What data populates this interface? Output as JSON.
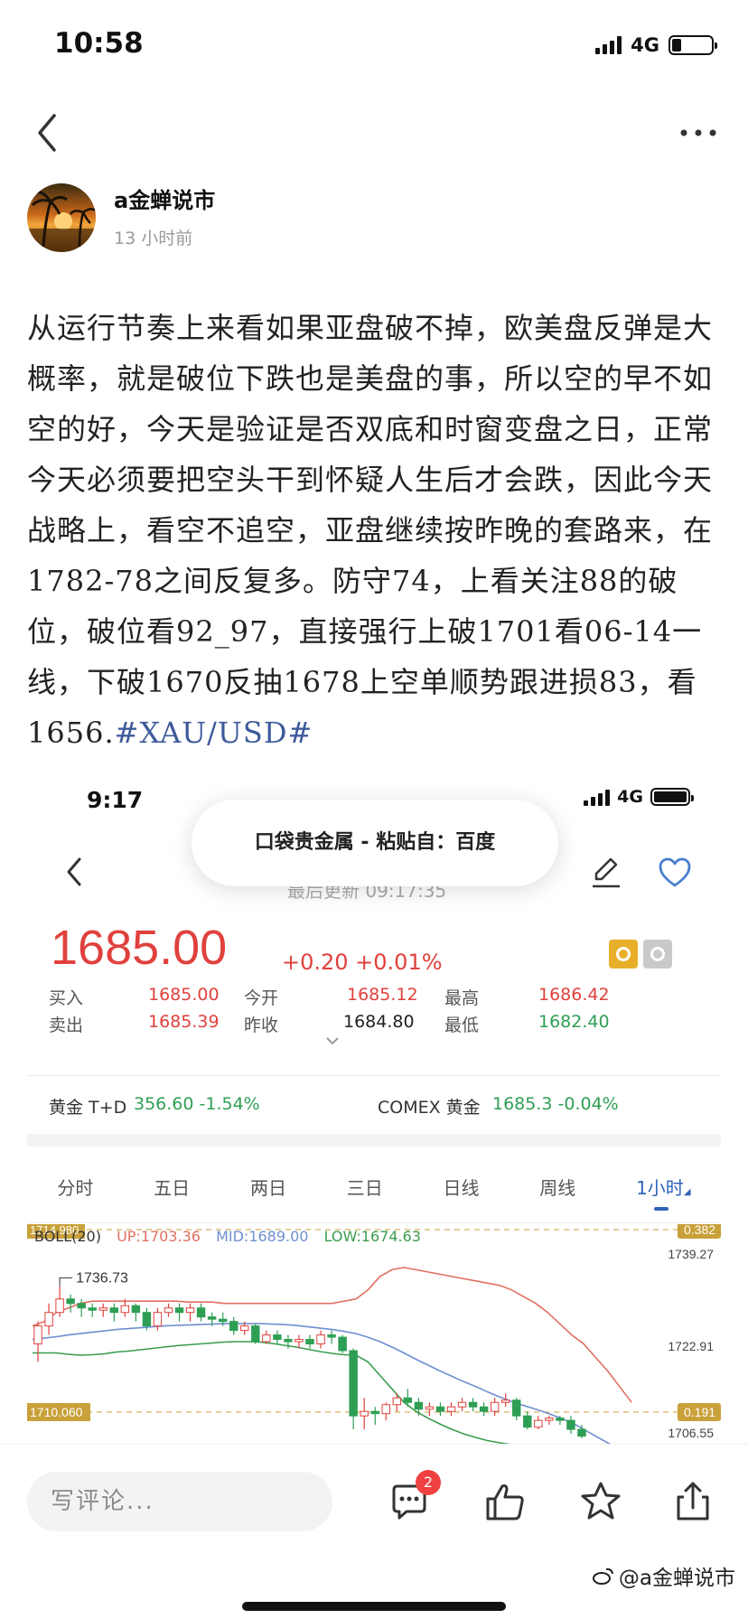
{
  "status_bar": {
    "time": "10:58",
    "network": "4G"
  },
  "author": {
    "name": "a金蝉说市",
    "time": "13 小时前"
  },
  "post": {
    "body": "从运行节奏上来看如果亚盘破不掉，欧美盘反弹是大概率，就是破位下跌也是美盘的事，所以空的早不如空的好，今天是验证是否双底和时窗变盘之日，正常今天必须要把空头干到怀疑人生后才会跌，因此今天战略上，看空不追空，亚盘继续按昨晚的套路来，在1782-78之间反复多。防守74，上看关注88的破位，破位看92_97，直接强行上破1701看06-14一线，下破1670反抽1678上空单顺势跟进损83，看1656.",
    "hashtag": "#XAU/USD#"
  },
  "embedded_screenshot": {
    "status_time": "9:17",
    "network": "4G",
    "paste_toast": "口袋贵金属 - 粘贴自：百度",
    "last_update": "最后更新 09:17:35",
    "price": "1685.00",
    "change": "+0.20 +0.01%",
    "quotes": {
      "buy_label": "买入",
      "buy": "1685.00",
      "sell_label": "卖出",
      "sell": "1685.39",
      "open_label": "今开",
      "open": "1685.12",
      "prev_close_label": "昨收",
      "prev_close": "1684.80",
      "high_label": "最高",
      "high": "1686.42",
      "low_label": "最低",
      "low": "1682.40"
    },
    "refs": {
      "td_label": "黄金 T+D",
      "td_value": "356.60 -1.54%",
      "comex_label": "COMEX 黄金",
      "comex_value": "1685.3 -0.04%"
    },
    "tabs": [
      "分时",
      "五日",
      "两日",
      "三日",
      "日线",
      "周线",
      "1小时"
    ],
    "active_tab": "1小时",
    "colors": {
      "up": "#e0413d",
      "down": "#2e9e54",
      "active": "#2f63b8",
      "upper_band": "#e07060",
      "mid_band": "#6f8fd0",
      "lower_band": "#3a9c50",
      "label_bg": "#c9a13a"
    },
    "chart_data": {
      "type": "candlestick",
      "indicator": "BOLL(20)",
      "up_label": "UP:1703.36",
      "mid_label": "MID:1689.00",
      "low_label": "LOW:1674.63",
      "left_top_label": "1714.980",
      "high_marker": "1736.73",
      "right_ticks": [
        "1739.27",
        "1722.91",
        "1706.55"
      ],
      "dashed_left_label": "1710.060",
      "dashed_right_top": "0.382",
      "dashed_right_mid": "0.191",
      "ylim": [
        1700,
        1745
      ],
      "candles": [
        {
          "o": 1724,
          "c": 1728,
          "h": 1729,
          "l": 1720
        },
        {
          "o": 1728,
          "c": 1731,
          "h": 1733,
          "l": 1726
        },
        {
          "o": 1731,
          "c": 1734,
          "h": 1736.7,
          "l": 1730
        },
        {
          "o": 1734,
          "c": 1733,
          "h": 1735,
          "l": 1731
        },
        {
          "o": 1733,
          "c": 1732,
          "h": 1734,
          "l": 1730
        },
        {
          "o": 1732,
          "c": 1731.5,
          "h": 1733,
          "l": 1730
        },
        {
          "o": 1731.5,
          "c": 1732,
          "h": 1733,
          "l": 1730
        },
        {
          "o": 1732,
          "c": 1731,
          "h": 1733,
          "l": 1729
        },
        {
          "o": 1731,
          "c": 1732.5,
          "h": 1734,
          "l": 1730
        },
        {
          "o": 1732.5,
          "c": 1731,
          "h": 1733,
          "l": 1729
        },
        {
          "o": 1731,
          "c": 1728,
          "h": 1732,
          "l": 1727
        },
        {
          "o": 1728,
          "c": 1731,
          "h": 1732,
          "l": 1727
        },
        {
          "o": 1731,
          "c": 1732,
          "h": 1733,
          "l": 1730
        },
        {
          "o": 1732,
          "c": 1731,
          "h": 1733,
          "l": 1729
        },
        {
          "o": 1731,
          "c": 1732,
          "h": 1733,
          "l": 1729
        },
        {
          "o": 1732,
          "c": 1730,
          "h": 1733,
          "l": 1729
        },
        {
          "o": 1730,
          "c": 1729.5,
          "h": 1731,
          "l": 1728
        },
        {
          "o": 1729.5,
          "c": 1729,
          "h": 1731,
          "l": 1728
        },
        {
          "o": 1729,
          "c": 1727,
          "h": 1730,
          "l": 1726
        },
        {
          "o": 1727,
          "c": 1728,
          "h": 1729,
          "l": 1726
        },
        {
          "o": 1728,
          "c": 1724.5,
          "h": 1728.5,
          "l": 1724
        },
        {
          "o": 1724.5,
          "c": 1726,
          "h": 1727,
          "l": 1724
        },
        {
          "o": 1726,
          "c": 1725,
          "h": 1727,
          "l": 1724
        },
        {
          "o": 1725,
          "c": 1724.5,
          "h": 1726,
          "l": 1723
        },
        {
          "o": 1724.5,
          "c": 1725,
          "h": 1726,
          "l": 1723
        },
        {
          "o": 1725,
          "c": 1724,
          "h": 1726,
          "l": 1723
        },
        {
          "o": 1724,
          "c": 1726,
          "h": 1727,
          "l": 1723
        },
        {
          "o": 1726,
          "c": 1725.5,
          "h": 1727,
          "l": 1724
        },
        {
          "o": 1725.5,
          "c": 1722.5,
          "h": 1726,
          "l": 1722
        },
        {
          "o": 1722.5,
          "c": 1708,
          "h": 1723,
          "l": 1705
        },
        {
          "o": 1708,
          "c": 1709,
          "h": 1712,
          "l": 1705
        },
        {
          "o": 1709,
          "c": 1708.5,
          "h": 1710,
          "l": 1706
        },
        {
          "o": 1708.5,
          "c": 1710.5,
          "h": 1711,
          "l": 1707
        },
        {
          "o": 1710.5,
          "c": 1712,
          "h": 1713,
          "l": 1709
        },
        {
          "o": 1712,
          "c": 1711,
          "h": 1714,
          "l": 1710
        },
        {
          "o": 1711,
          "c": 1709.5,
          "h": 1712,
          "l": 1708
        },
        {
          "o": 1709.5,
          "c": 1710,
          "h": 1711,
          "l": 1708
        },
        {
          "o": 1710,
          "c": 1709,
          "h": 1711,
          "l": 1708
        },
        {
          "o": 1709,
          "c": 1710,
          "h": 1711,
          "l": 1708
        },
        {
          "o": 1710,
          "c": 1711,
          "h": 1712,
          "l": 1709
        },
        {
          "o": 1711,
          "c": 1710,
          "h": 1712,
          "l": 1709
        },
        {
          "o": 1710,
          "c": 1709,
          "h": 1711,
          "l": 1708
        },
        {
          "o": 1709,
          "c": 1711,
          "h": 1712,
          "l": 1708
        },
        {
          "o": 1711,
          "c": 1711.5,
          "h": 1713,
          "l": 1710
        },
        {
          "o": 1711.5,
          "c": 1708,
          "h": 1712,
          "l": 1707
        },
        {
          "o": 1708,
          "c": 1705.5,
          "h": 1709,
          "l": 1705
        },
        {
          "o": 1705.5,
          "c": 1707,
          "h": 1708,
          "l": 1705
        },
        {
          "o": 1707,
          "c": 1707.5,
          "h": 1708,
          "l": 1706
        },
        {
          "o": 1707.5,
          "c": 1707,
          "h": 1708,
          "l": 1706
        },
        {
          "o": 1707,
          "c": 1705,
          "h": 1708,
          "l": 1704
        },
        {
          "o": 1705,
          "c": 1703.5,
          "h": 1706,
          "l": 1703
        }
      ],
      "upper_band": [
        1728,
        1729,
        1731,
        1732,
        1733,
        1733.5,
        1733.5,
        1733.5,
        1733.5,
        1733.5,
        1733.5,
        1733.5,
        1733.5,
        1733.3,
        1733.3,
        1733.3,
        1733,
        1733,
        1733,
        1733,
        1733,
        1733,
        1733,
        1733,
        1733,
        1733,
        1733.5,
        1734,
        1736,
        1739,
        1740.5,
        1741,
        1740.5,
        1740,
        1739.5,
        1739,
        1738.5,
        1738,
        1737.5,
        1737,
        1736,
        1734.5,
        1733,
        1731,
        1728.5,
        1726,
        1724,
        1721,
        1718,
        1714.5,
        1711
      ],
      "mid_band": [
        1725,
        1725.3,
        1725.6,
        1726,
        1726.3,
        1726.6,
        1726.9,
        1727.2,
        1727.4,
        1727.6,
        1727.8,
        1728,
        1728.1,
        1728.2,
        1728.3,
        1728.4,
        1728.5,
        1728.5,
        1728.5,
        1728.5,
        1728.4,
        1728.3,
        1728.1,
        1727.8,
        1727.5,
        1727.2,
        1726.8,
        1726.3,
        1725.5,
        1724.5,
        1723.3,
        1722,
        1720.6,
        1719.3,
        1718,
        1716.8,
        1715.6,
        1714.5,
        1713.3,
        1712.2,
        1711.2,
        1710.3,
        1709.5,
        1708.6,
        1707.6,
        1706.5,
        1705,
        1703.5,
        1702,
        1700.5,
        1699
      ],
      "lower_band": [
        1722,
        1722,
        1722,
        1721.7,
        1721.5,
        1721.6,
        1721.8,
        1722.2,
        1722.4,
        1722.7,
        1723,
        1723.3,
        1723.6,
        1723.8,
        1724,
        1724.2,
        1724.4,
        1724.5,
        1724.5,
        1724.4,
        1724.1,
        1723.7,
        1723.3,
        1722.8,
        1722.3,
        1721.9,
        1721.6,
        1721.5,
        1720,
        1717,
        1714,
        1711,
        1709,
        1707.5,
        1706.2,
        1705,
        1704,
        1703.2,
        1702.5,
        1702,
        1701.6,
        1701.3,
        1701,
        1700.8,
        1700.6,
        1700.4,
        1700.3,
        1700.2,
        1700.1,
        1700,
        1700
      ]
    }
  },
  "bottom_bar": {
    "comment_placeholder": "写评论...",
    "comment_count": "2",
    "watermark": "@a金蝉说市"
  }
}
